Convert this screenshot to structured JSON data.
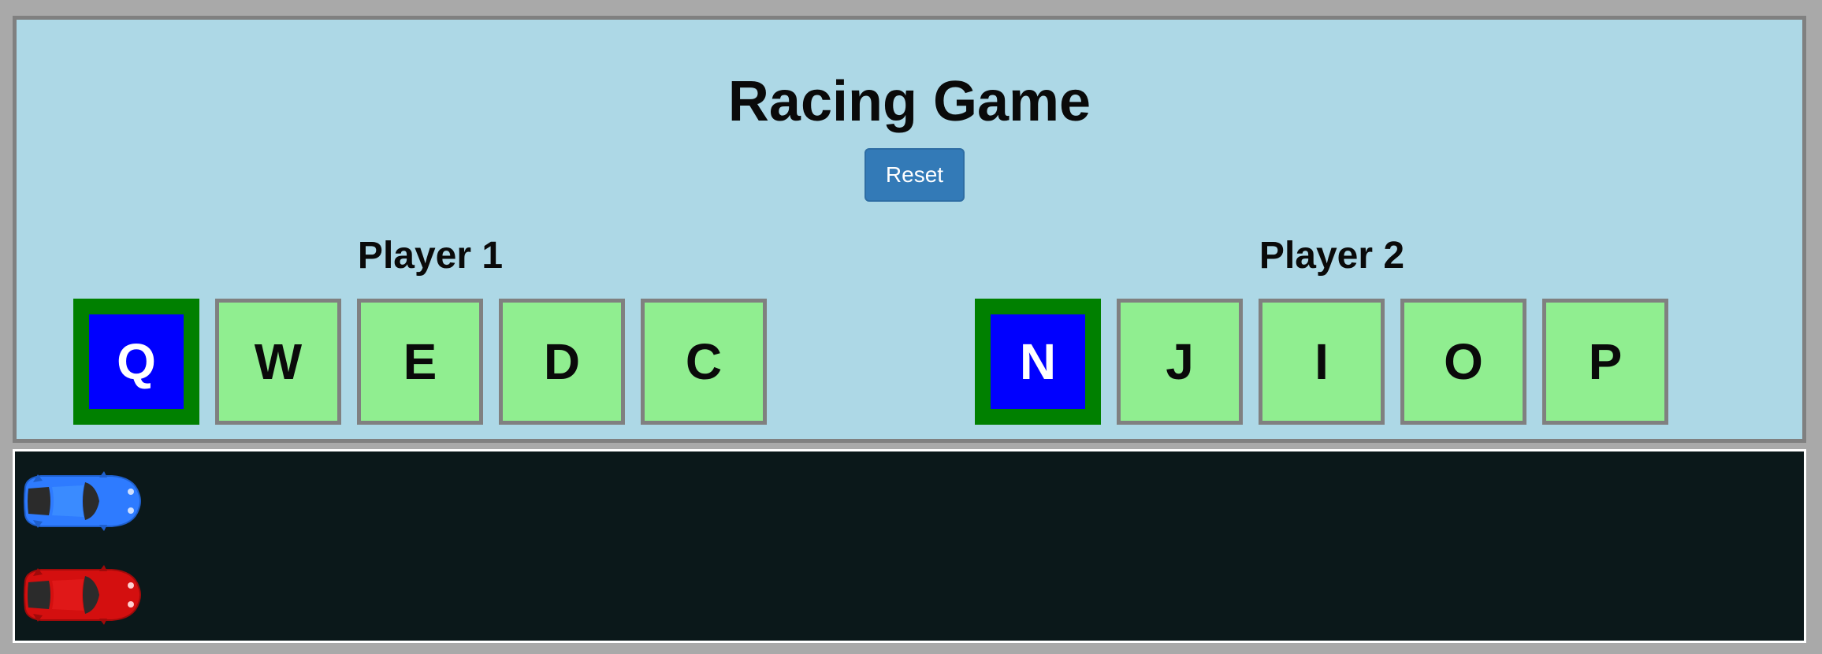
{
  "title": "Racing Game",
  "reset_label": "Reset",
  "players": [
    {
      "label": "Player 1",
      "keys": [
        "Q",
        "W",
        "E",
        "D",
        "C"
      ],
      "active_index": 0,
      "car_color": "#2e7bff"
    },
    {
      "label": "Player 2",
      "keys": [
        "N",
        "J",
        "I",
        "O",
        "P"
      ],
      "active_index": 0,
      "car_color": "#d40f0f"
    }
  ],
  "colors": {
    "panel_bg": "#add8e6",
    "key_idle": "#90ee90",
    "key_active_fill": "#0000ff",
    "key_active_border": "#008000",
    "track_bg": "#0b181a",
    "reset_button": "#337ab7"
  },
  "icons": {
    "car": "car-top-view-icon"
  }
}
